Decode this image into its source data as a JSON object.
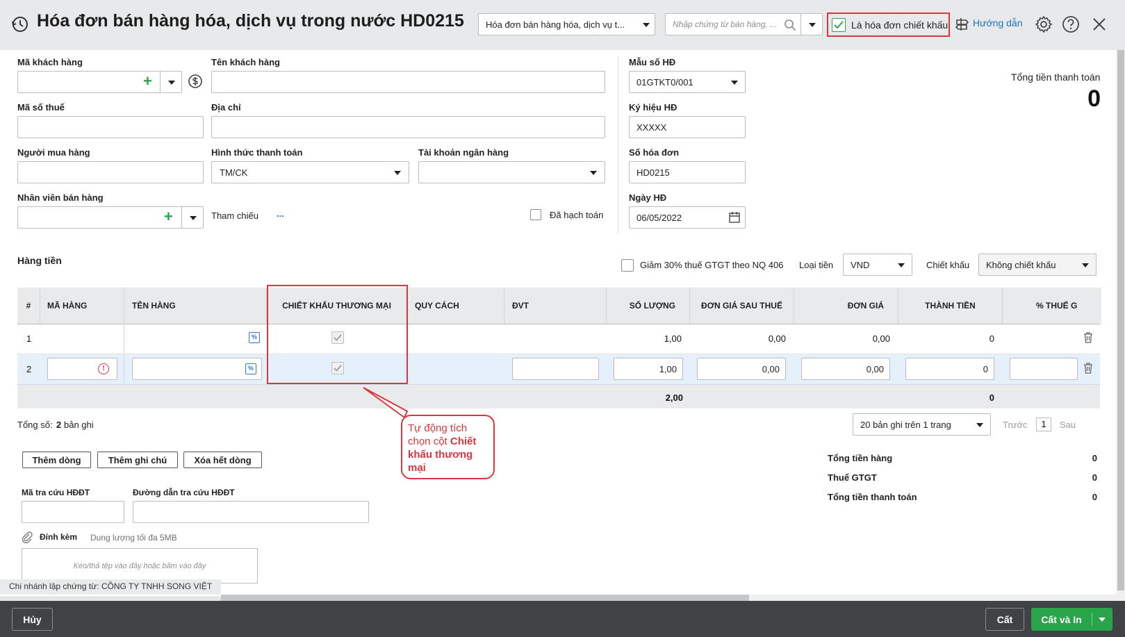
{
  "header": {
    "title": "Hóa đơn bán hàng hóa, dịch vụ trong nước HD0215",
    "type_select": "Hóa đơn bán hàng hóa, dịch vụ t...",
    "search_placeholder": "Nhập chứng từ bán hàng, ...",
    "discount_invoice_label": "Là hóa đơn chiết khấu",
    "help_link": "Hướng dẫn"
  },
  "form": {
    "customer_code_label": "Mã khách hàng",
    "customer_name_label": "Tên khách hàng",
    "tax_code_label": "Mã số thuế",
    "address_label": "Địa chỉ",
    "buyer_label": "Người mua hàng",
    "payment_method_label": "Hình thức thanh toán",
    "payment_method_value": "TM/CK",
    "bank_account_label": "Tài khoản ngân hàng",
    "sales_staff_label": "Nhân viên bán hàng",
    "reference_label": "Tham chiếu",
    "reference_dots": "...",
    "posted_label": "Đã hạch toán",
    "invoice_template_label": "Mẫu số HĐ",
    "invoice_template_value": "01GTKT0/001",
    "invoice_symbol_label": "Ký hiệu HĐ",
    "invoice_symbol_value": "XXXXX",
    "invoice_number_label": "Số hóa đơn",
    "invoice_number_value": "HD0215",
    "invoice_date_label": "Ngày HĐ",
    "invoice_date_value": "06/05/2022",
    "total_payment_label": "Tổng tiền thanh toán",
    "total_payment_value": "0"
  },
  "grid": {
    "section_label": "Hàng tiền",
    "vat_reduction_label": "Giảm 30% thuế GTGT theo NQ 406",
    "currency_label": "Loại tiền",
    "currency_value": "VND",
    "discount_label": "Chiết khấu",
    "discount_value": "Không chiết khấu",
    "columns": [
      "#",
      "MÃ HÀNG",
      "TÊN HÀNG",
      "CHIẾT KHẤU THƯƠNG MẠI",
      "QUY CÁCH",
      "ĐVT",
      "SỐ LƯỢNG",
      "ĐƠN GIÁ SAU THUẾ",
      "ĐƠN GIÁ",
      "THÀNH TIỀN",
      "% THUẾ G"
    ],
    "rows": [
      {
        "no": "1",
        "qty": "1,00",
        "price_after_tax": "0,00",
        "price": "0,00",
        "amount": "0"
      },
      {
        "no": "2",
        "qty": "1,00",
        "price_after_tax": "0,00",
        "price": "0,00",
        "amount": "0"
      }
    ],
    "total_qty": "2,00",
    "total_amount": "0",
    "record_count_prefix": "Tổng số:",
    "record_count_value": "2",
    "record_count_suffix": "bản ghi",
    "page_size": "20 bản ghi trên 1 trang",
    "prev": "Trước",
    "page": "1",
    "next": "Sau"
  },
  "actions": {
    "add_row": "Thêm dòng",
    "add_note": "Thêm ghi chú",
    "delete_all": "Xóa hết dòng"
  },
  "einvoice": {
    "lookup_code_label": "Mã tra cứu HĐĐT",
    "lookup_url_label": "Đường dẫn tra cứu HĐĐT",
    "attach_label": "Đính kèm",
    "attach_limit": "Dung lượng tối đa 5MB",
    "drop_hint": "Kéo/thả tệp vào đây hoặc bấm vào đây"
  },
  "summary": {
    "goods_total_label": "Tổng tiền hàng",
    "goods_total_value": "0",
    "vat_label": "Thuế GTGT",
    "vat_value": "0",
    "payment_total_label": "Tổng tiền thanh toán",
    "payment_total_value": "0"
  },
  "branch": "Chi nhánh lập chứng từ: CÔNG TY TNHH SONG VIỆT",
  "callout": {
    "line1": "Tự động tích chọn cột ",
    "bold": "Chiết khấu thương mại"
  },
  "footer": {
    "cancel": "Hủy",
    "save": "Cất",
    "save_print": "Cất và In"
  },
  "colors": {
    "highlight": "#d9363e",
    "primary_green": "#2aa44a",
    "link_blue": "#1a73c9"
  }
}
